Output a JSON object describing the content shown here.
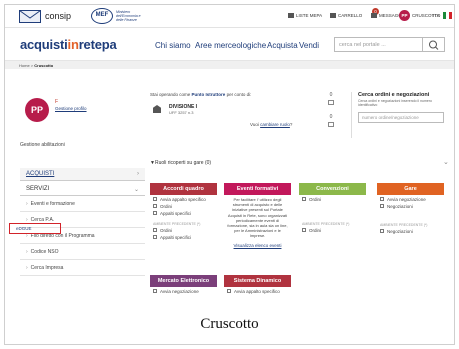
{
  "topbar": {
    "brand": "consip",
    "mef_logo": "MEF",
    "mef_sub": "Ministero dell'Economia e delle Finanze",
    "items": [
      "LISTE MEPA",
      "CARRELLO",
      "MESSAGGI",
      "CRUSCOTTO",
      "ITA"
    ],
    "messages_badge": "0",
    "avatar_initials": "PP"
  },
  "nav": {
    "logo_a": "acquisti",
    "logo_b": "in",
    "logo_c": "retepa",
    "items": [
      "Chi siamo",
      "Aree merceologiche",
      "Acquista",
      "Vendi",
      "Supporto"
    ],
    "search_placeholder": "cerca nel portale ..."
  },
  "breadcrumb": {
    "home": "Home",
    "sep": ">",
    "current": "Cruscotto"
  },
  "profile": {
    "initials": "PP",
    "name": "F",
    "link": "Gestione profilo",
    "abilitazioni": "Gestione abilitazioni"
  },
  "sidebar": {
    "acquisti": "ACQUISTI",
    "servizi": "SERVIZI",
    "items": [
      "Eventi e formazione",
      "Cerca P.A.",
      "Filo diretto con il Programma",
      "Codice NSO",
      "Cerca Impresa"
    ],
    "egi": "eDGUE"
  },
  "operating": {
    "prefix": "Stai operando come",
    "role": "Punto Istruttore",
    "suffix": "per conto di:",
    "division": "DIVISIONE I",
    "division_sub": "UFF 3257 n.3",
    "change_prefix": "Vuoi",
    "change_link": "cambiare ruolo",
    "change_suffix": "?"
  },
  "counters": [
    "0",
    "0"
  ],
  "orders": {
    "title": "Cerca ordini e negoziazioni",
    "subtitle": "Cerca ordini e negoziazioni inserendo il numero identificativo",
    "placeholder": "numero ordine/negoziazione"
  },
  "ricopiti": "Ruoli ricoperti su gare (0)",
  "cards": {
    "accordi": {
      "title": "Accordi quadro",
      "color": "#b0333f",
      "items": [
        "Avvia appalto specifico",
        "Ordini",
        "Appalti specifici"
      ],
      "section": "AMBIENTE PRECEDENTE (*)",
      "items2": [
        "Ordini",
        "Appalti specifici"
      ]
    },
    "eventi": {
      "title": "Eventi formativi",
      "color": "#c2185b",
      "text": "Per facilitare l' utilizzo degli strumenti di acquisto e delle iniziative presenti sul Portale Acquisti in Rete, sono organizzati periodicamente eventi di formazione, sia in aula sia on line, per le Amministrazioni e le Imprese.",
      "link": "Visualizza elenco eventi"
    },
    "convenzioni": {
      "title": "Convenzioni",
      "color": "#8cb84a",
      "items": [
        "Ordini"
      ],
      "section": "AMBIENTE PRECEDENTE (*)",
      "items2": [
        "Ordini"
      ]
    },
    "gare": {
      "title": "Gare",
      "color": "#e06322",
      "items": [
        "Avvia negoziazione",
        "Negoziazioni"
      ],
      "section": "AMBIENTE PRECEDENTE (*)",
      "items2": [
        "Negoziazioni"
      ]
    },
    "mercato": {
      "title": "Mercato Elettronico",
      "color": "#7b3f7a",
      "items": [
        "Avvia negoziazione"
      ]
    },
    "sistema": {
      "title": "Sistema Dinamico",
      "color": "#b0333f",
      "items": [
        "Avvia appalto specifico"
      ]
    }
  },
  "caption": "Cruscotto"
}
